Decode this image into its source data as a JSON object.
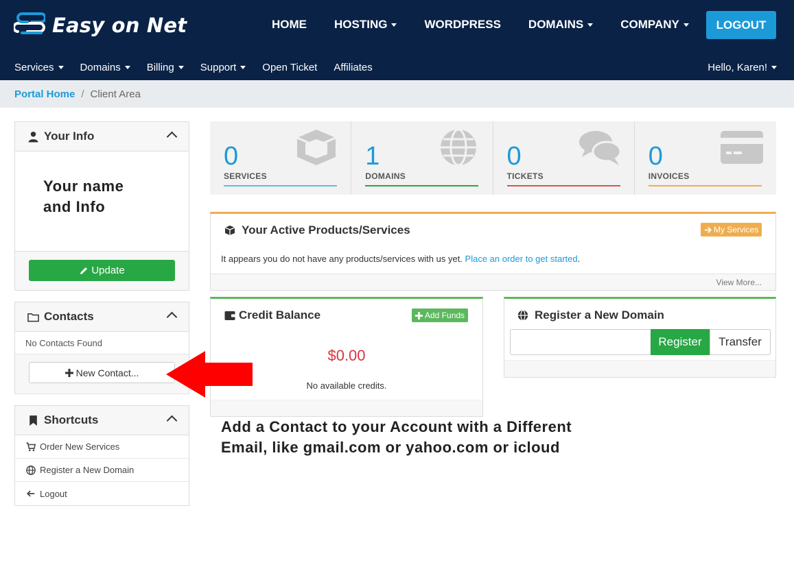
{
  "brand": {
    "name": "Easy on Net"
  },
  "main_nav": {
    "items": [
      {
        "label": "HOME",
        "dropdown": false
      },
      {
        "label": "HOSTING",
        "dropdown": true
      },
      {
        "label": "WORDPRESS",
        "dropdown": false
      },
      {
        "label": "DOMAINS",
        "dropdown": true
      },
      {
        "label": "COMPANY",
        "dropdown": true
      }
    ],
    "logout_label": "LOGOUT"
  },
  "sub_nav": {
    "items": [
      {
        "label": "Services",
        "dropdown": true
      },
      {
        "label": "Domains",
        "dropdown": true
      },
      {
        "label": "Billing",
        "dropdown": true
      },
      {
        "label": "Support",
        "dropdown": true
      },
      {
        "label": "Open Ticket",
        "dropdown": false
      },
      {
        "label": "Affiliates",
        "dropdown": false
      }
    ],
    "greeting": "Hello, Karen!"
  },
  "breadcrumb": {
    "home": "Portal Home",
    "separator": "/",
    "current": "Client Area"
  },
  "sidebar": {
    "your_info": {
      "title": "Your Info",
      "placeholder_line1": "Your name",
      "placeholder_line2": "and Info",
      "update_label": "Update"
    },
    "contacts": {
      "title": "Contacts",
      "empty_text": "No Contacts Found",
      "new_contact_label": "New Contact..."
    },
    "shortcuts": {
      "title": "Shortcuts",
      "items": [
        {
          "label": "Order New Services",
          "icon": "cart-icon"
        },
        {
          "label": "Register a New Domain",
          "icon": "globe-icon"
        },
        {
          "label": "Logout",
          "icon": "arrow-left-icon"
        }
      ]
    }
  },
  "stats": [
    {
      "value": "0",
      "label": "SERVICES",
      "color": "#5bc0de",
      "icon": "cube-icon"
    },
    {
      "value": "1",
      "label": "DOMAINS",
      "color": "#28a745",
      "icon": "globe-icon"
    },
    {
      "value": "0",
      "label": "TICKETS",
      "color": "#d9534f",
      "icon": "comments-icon"
    },
    {
      "value": "0",
      "label": "INVOICES",
      "color": "#f0ad4e",
      "icon": "credit-card-icon"
    }
  ],
  "active_products": {
    "title": "Your Active Products/Services",
    "button_label": "My Services",
    "message": "It appears you do not have any products/services with us yet.",
    "link_text": "Place an order to get started",
    "link_suffix": ".",
    "view_more": "View More..."
  },
  "credit_balance": {
    "title": "Credit Balance",
    "add_funds_label": "Add Funds",
    "amount": "$0.00",
    "note": "No available credits."
  },
  "register_domain": {
    "title": "Register a New Domain",
    "input_value": "",
    "register_label": "Register",
    "transfer_label": "Transfer"
  },
  "annotation": {
    "line1": "Add a Contact to your Account with a Different",
    "line2": "Email, like gmail.com or yahoo.com or icloud"
  },
  "colors": {
    "navy": "#0a2246",
    "accent_blue": "#1c9ad8",
    "green": "#28a745",
    "orange": "#f0ad4e",
    "red_amount": "#d9343f",
    "arrow_red": "#ff0000"
  }
}
